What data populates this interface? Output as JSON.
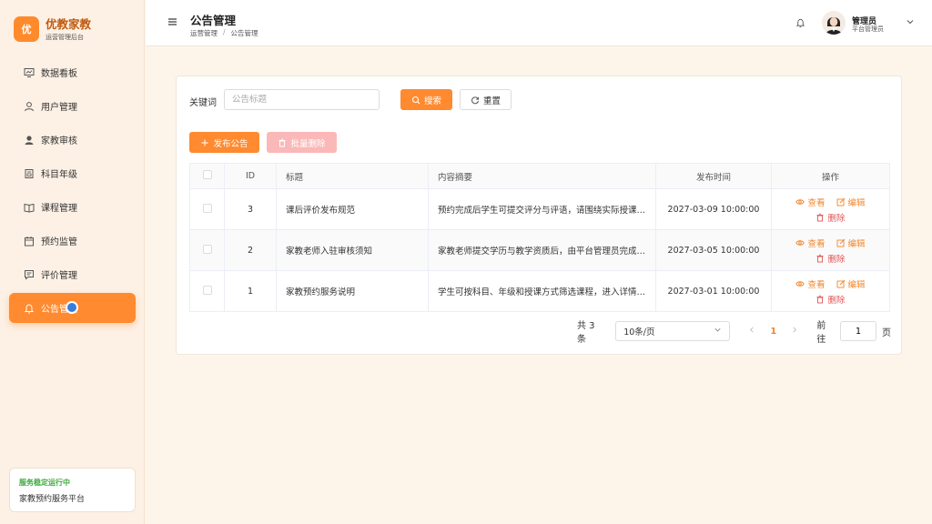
{
  "brand": {
    "logo": "优",
    "name": "优教家教",
    "subtitle": "运营管理后台"
  },
  "nav": [
    {
      "label": "数据看板",
      "icon": "dashboard-icon"
    },
    {
      "label": "用户管理",
      "icon": "user-icon"
    },
    {
      "label": "家教审核",
      "icon": "teacher-icon"
    },
    {
      "label": "科目年级",
      "icon": "book-icon"
    },
    {
      "label": "课程管理",
      "icon": "course-icon"
    },
    {
      "label": "预约监管",
      "icon": "calendar-icon"
    },
    {
      "label": "评价管理",
      "icon": "comment-icon"
    },
    {
      "label": "公告管理",
      "icon": "bell-icon",
      "active": true
    }
  ],
  "status": {
    "title": "服务稳定运行中",
    "subtitle": "家教预约服务平台"
  },
  "header": {
    "title": "公告管理",
    "breadcrumb": [
      "运营管理",
      "/",
      "公告管理"
    ],
    "user_name": "管理员",
    "user_role": "平台管理员"
  },
  "filter": {
    "keyword_label": "关键词",
    "keyword_placeholder": "公告标题",
    "search_label": "搜索",
    "reset_label": "重置"
  },
  "actions": {
    "add_label": "发布公告",
    "batch_delete_label": "批量删除"
  },
  "table": {
    "columns": [
      "ID",
      "标题",
      "内容摘要",
      "发布时间",
      "操作"
    ],
    "rows": [
      {
        "id": "3",
        "title": "课后评价发布规范",
        "summary": "预约完成后学生可提交评分与评语，请围绕实际授课情况进行评价",
        "time": "2027-03-09 10:00:00"
      },
      {
        "id": "2",
        "title": "家教老师入驻审核须知",
        "summary": "家教老师提交学历与教学资质后，由平台管理员完成审核",
        "time": "2027-03-05 10:00:00"
      },
      {
        "id": "1",
        "title": "家教预约服务说明",
        "summary": "学生可按科目、年级和授课方式筛选课程，进入详情页预约",
        "time": "2027-03-01 10:00:00"
      }
    ],
    "op_view": "查看",
    "op_edit": "编辑",
    "op_delete": "删除"
  },
  "pagination": {
    "total_text": "共 3 条",
    "page_size": "10条/页",
    "current_page": "1",
    "goto_label": "前往",
    "goto_value": "1",
    "page_unit": "页"
  },
  "colors": {
    "accent": "#ff8a30",
    "danger": "#e15555",
    "success": "#3aa83a"
  }
}
